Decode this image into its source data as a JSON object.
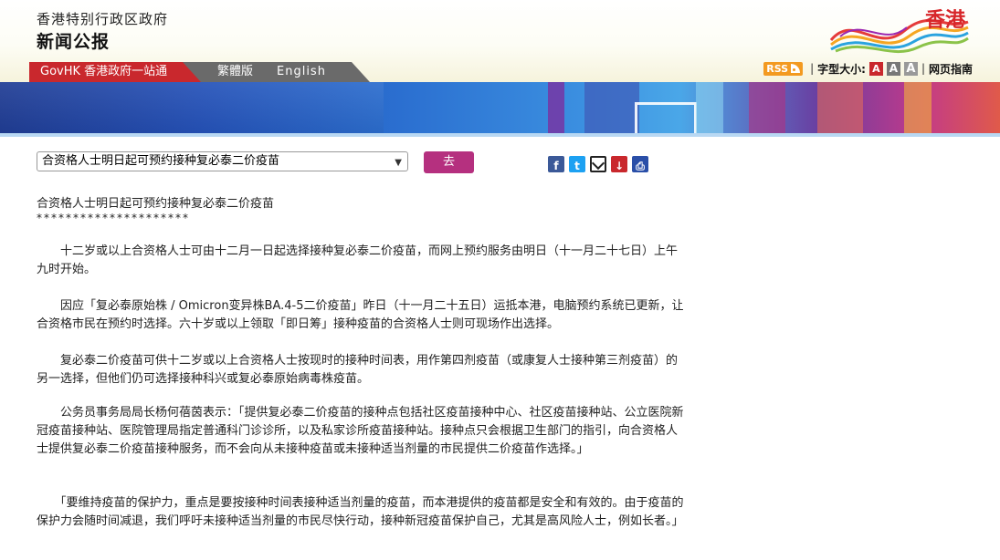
{
  "header": {
    "gov_name": "香港特别行政区政府",
    "press_title": "新闻公报",
    "logo_text": "香港"
  },
  "nav": {
    "govhk": "GovHK 香港政府一站通",
    "traditional": "繁體版",
    "english": "English"
  },
  "tools": {
    "rss": "RSS",
    "font_size_label": "字型大小:",
    "font_sizes": [
      "A",
      "A",
      "A"
    ],
    "site_guide": "网页指南"
  },
  "selector": {
    "selected_title": "合资格人士明日起可预约接种复必泰二价疫苗",
    "go_label": "去"
  },
  "share": {
    "icons": [
      "facebook-icon",
      "twitter-icon",
      "email-icon",
      "save-icon",
      "print-icon"
    ]
  },
  "article": {
    "title": "合资格人士明日起可预约接种复必泰二价疫苗",
    "stars": "*********************",
    "paragraphs": [
      "　　十二岁或以上合资格人士可由十二月一日起选择接种复必泰二价疫苗，而网上预约服务由明日（十一月二十七日）上午九时开始。",
      "　　因应「复必泰原始株 / Omicron变异株BA.4-5二价疫苗」昨日（十一月二十五日）运抵本港，电脑预约系统已更新，让合资格市民在预约时选择。六十岁或以上领取「即日筹」接种疫苗的合资格人士则可现场作出选择。",
      "　　复必泰二价疫苗可供十二岁或以上合资格人士按现时的接种时间表，用作第四剂疫苗（或康复人士接种第三剂疫苗）的另一选择，但他们仍可选择接种科兴或复必泰原始病毒株疫苗。",
      "　　公务员事务局局长杨何蓓茵表示：「提供复必泰二价疫苗的接种点包括社区疫苗接种中心、社区疫苗接种站、公立医院新冠疫苗接种站、医院管理局指定普通科门诊诊所，以及私家诊所疫苗接种站。接种点只会根据卫生部门的指引，向合资格人士提供复必泰二价疫苗接种服务，而不会向从未接种疫苗或未接种适当剂量的市民提供二价疫苗作选择。」",
      "　　「要维持疫苗的保护力，重点是要按接种时间表接种适当剂量的疫苗，而本港提供的疫苗都是安全和有效的。由于疫苗的保护力会随时间减退，我们呼吁未接种适当剂量的市民尽快行动，接种新冠疫苗保护自己，尤其是高风险人士，例如长者。」"
    ]
  },
  "colors": {
    "brand_red": "#c9282d",
    "go_button": "#b5307f",
    "nav_gray": "#6a6a6a"
  }
}
